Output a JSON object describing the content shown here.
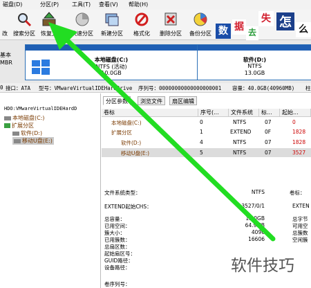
{
  "menu": [
    "磁盘(D)",
    "分区(P)",
    "工具(T)",
    "查看(V)",
    "帮助(H)"
  ],
  "toolbar": [
    {
      "label": "改",
      "icon": "save-icon"
    },
    {
      "label": "搜索分区",
      "icon": "search-icon"
    },
    {
      "label": "恢复文",
      "icon": "restore-icon"
    },
    {
      "label": "快速分区",
      "icon": "quick-partition-icon"
    },
    {
      "label": "新建分区",
      "icon": "new-partition-icon"
    },
    {
      "label": "格式化",
      "icon": "format-icon"
    },
    {
      "label": "删除分区",
      "icon": "delete-partition-icon"
    },
    {
      "label": "备份分区",
      "icon": "backup-partition-icon"
    }
  ],
  "ad_chars": [
    "数",
    "据",
    "去",
    "失",
    "怎",
    "么"
  ],
  "disk_left": {
    "line1": "基本",
    "line2": "MBR"
  },
  "partitions": [
    {
      "name": "本地磁盘(C:)",
      "fs": "NTFS (活动)",
      "size": "10.0GB"
    },
    {
      "name": "软件(D:)",
      "fs": "NTFS",
      "size": "13.0GB"
    }
  ],
  "infoline": {
    "disk": "0",
    "iface": "接口：ATA",
    "model": "型号：VMwareVirtualIDEHardDrive",
    "serial": "序列号：00000000000000000001",
    "cap": "容量：40.0GB(40960MB)",
    "cyl": "柱"
  },
  "tree": [
    "HDO:VMwareVirtualIDEHardD",
    "本地磁盘(C:)",
    "扩展分区",
    "软件(D:)",
    "移动U盘(E:)"
  ],
  "tabs": [
    "分区参数",
    "浏览文件",
    "扇区编辑"
  ],
  "table": {
    "headers": [
      "卷标",
      "序号(...",
      "文件系统",
      "标...",
      "起始..."
    ],
    "rows": [
      {
        "label": "本地磁盘(C:)",
        "no": "0",
        "fs": "NTFS",
        "id": "07",
        "start": "0"
      },
      {
        "label": "扩展分区",
        "no": "1",
        "fs": "EXTEND",
        "id": "0F",
        "start": "1828"
      },
      {
        "label": "软件(D:)",
        "no": "4",
        "fs": "NTFS",
        "id": "07",
        "start": "1828"
      },
      {
        "label": "移动U盘(E:)",
        "no": "5",
        "fs": "NTFS",
        "id": "07",
        "start": "3527"
      }
    ]
  },
  "details": {
    "fs_type": "文件系统类型：",
    "fs_val": "NTFS",
    "vol_lbl": "卷标：",
    "chs": "EXTEND起始CHS：",
    "chs_val": "3527/0/1",
    "chs_right": "EXTEN",
    "rows": [
      {
        "label": "总容量：",
        "value": "13.0GB",
        "right": "总字节"
      },
      {
        "label": "已用空间：",
        "value": "64.9MB",
        "right": "可用空"
      },
      {
        "label": "簇大小：",
        "value": "4096",
        "right": "总簇数"
      },
      {
        "label": "已用簇数：",
        "value": "16606",
        "right": "空闲簇"
      },
      {
        "label": "总扇区数：",
        "value": "",
        "right": ""
      },
      {
        "label": "起始扇区号：",
        "value": "",
        "right": ""
      },
      {
        "label": "GUID路径：",
        "value": "",
        "right": ""
      },
      {
        "label": "设备路径：",
        "value": "",
        "right": ""
      }
    ],
    "serial": "卷序列号："
  },
  "watermark": "软件技巧",
  "colors": {
    "arrow": "#22dd22",
    "part_bar": "#1f5fb4",
    "ad_blue": "#1a4da8",
    "ad_red": "#d21f2e",
    "ad_green": "#2a9c3a",
    "ad_navy": "#1b3f8a"
  }
}
